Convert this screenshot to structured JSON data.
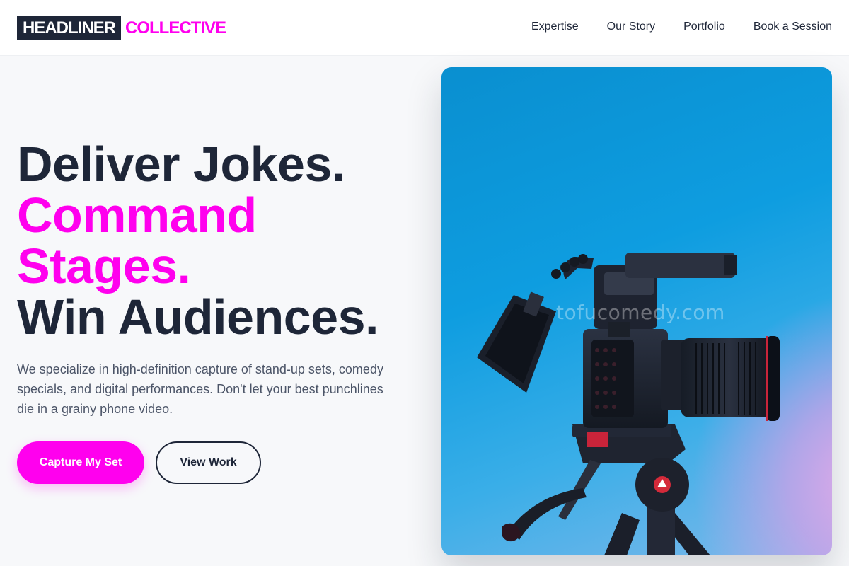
{
  "brand": {
    "name_box": "HEADLINER",
    "name_accent": "COLLECTIVE",
    "accent_color": "#ff00ee",
    "dark_color": "#1e2638"
  },
  "nav": {
    "items": [
      {
        "label": "Expertise"
      },
      {
        "label": "Our Story"
      },
      {
        "label": "Portfolio"
      },
      {
        "label": "Book a Session"
      }
    ]
  },
  "hero": {
    "title_line1": "Deliver Jokes.",
    "title_line2": "Command",
    "title_line3": "Stages.",
    "title_line4": "Win Audiences.",
    "description": "We specialize in high-definition capture of stand-up sets, comedy specials, and digital performances. Don't let your best punchlines die in a grainy phone video.",
    "primary_button": "Capture My Set",
    "secondary_button": "View Work"
  },
  "image": {
    "subject": "cinema-camera-on-tripod",
    "watermark": "tofucomedy.com"
  }
}
